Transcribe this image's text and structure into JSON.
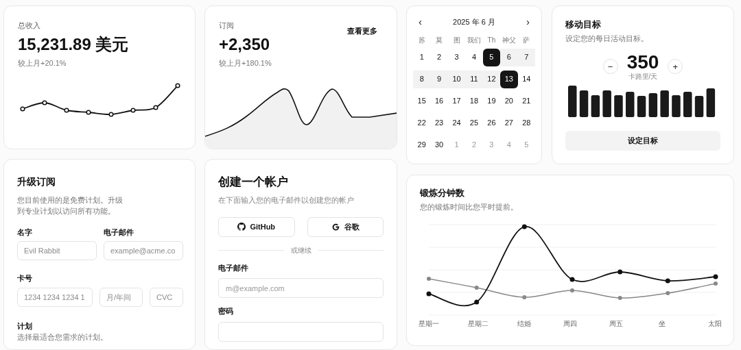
{
  "revenue": {
    "label": "总收入",
    "value": "15,231.89 美元",
    "change": "较上月+20.1%"
  },
  "subscriptions": {
    "label": "订阅",
    "value": "+2,350",
    "change": "较上月+180.1%",
    "link": "查看更多"
  },
  "calendar": {
    "prev": "‹",
    "title": "2025 年 6 月",
    "next": "›",
    "weekdays": [
      "苏",
      "莫",
      "图",
      "我们",
      "Th",
      "神父",
      "萨"
    ],
    "days": [
      {
        "label": "1",
        "outside": false,
        "selected": false,
        "in_range": false
      },
      {
        "label": "2",
        "outside": false,
        "selected": false,
        "in_range": false
      },
      {
        "label": "3",
        "outside": false,
        "selected": false,
        "in_range": false
      },
      {
        "label": "4",
        "outside": false,
        "selected": false,
        "in_range": false
      },
      {
        "label": "5",
        "outside": false,
        "selected": true,
        "in_range": true
      },
      {
        "label": "6",
        "outside": false,
        "selected": false,
        "in_range": true
      },
      {
        "label": "7",
        "outside": false,
        "selected": false,
        "in_range": true
      },
      {
        "label": "8",
        "outside": false,
        "selected": false,
        "in_range": true
      },
      {
        "label": "9",
        "outside": false,
        "selected": false,
        "in_range": true
      },
      {
        "label": "10",
        "outside": false,
        "selected": false,
        "in_range": true
      },
      {
        "label": "11",
        "outside": false,
        "selected": false,
        "in_range": true
      },
      {
        "label": "12",
        "outside": false,
        "selected": false,
        "in_range": true
      },
      {
        "label": "13",
        "outside": false,
        "selected": true,
        "in_range": true
      },
      {
        "label": "14",
        "outside": false,
        "selected": false,
        "in_range": false
      },
      {
        "label": "15",
        "outside": false,
        "selected": false,
        "in_range": false
      },
      {
        "label": "16",
        "outside": false,
        "selected": false,
        "in_range": false
      },
      {
        "label": "17",
        "outside": false,
        "selected": false,
        "in_range": false
      },
      {
        "label": "18",
        "outside": false,
        "selected": false,
        "in_range": false
      },
      {
        "label": "19",
        "outside": false,
        "selected": false,
        "in_range": false
      },
      {
        "label": "20",
        "outside": false,
        "selected": false,
        "in_range": false
      },
      {
        "label": "21",
        "outside": false,
        "selected": false,
        "in_range": false
      },
      {
        "label": "22",
        "outside": false,
        "selected": false,
        "in_range": false
      },
      {
        "label": "23",
        "outside": false,
        "selected": false,
        "in_range": false
      },
      {
        "label": "24",
        "outside": false,
        "selected": false,
        "in_range": false
      },
      {
        "label": "25",
        "outside": false,
        "selected": false,
        "in_range": false
      },
      {
        "label": "26",
        "outside": false,
        "selected": false,
        "in_range": false
      },
      {
        "label": "27",
        "outside": false,
        "selected": false,
        "in_range": false
      },
      {
        "label": "28",
        "outside": false,
        "selected": false,
        "in_range": false
      },
      {
        "label": "29",
        "outside": false,
        "selected": false,
        "in_range": false
      },
      {
        "label": "30",
        "outside": false,
        "selected": false,
        "in_range": false
      },
      {
        "label": "1",
        "outside": true,
        "selected": false,
        "in_range": false
      },
      {
        "label": "2",
        "outside": true,
        "selected": false,
        "in_range": false
      },
      {
        "label": "3",
        "outside": true,
        "selected": false,
        "in_range": false
      },
      {
        "label": "4",
        "outside": true,
        "selected": false,
        "in_range": false
      },
      {
        "label": "5",
        "outside": true,
        "selected": false,
        "in_range": false
      }
    ]
  },
  "move_goal": {
    "title": "移动目标",
    "description": "设定您的每日活动目标。",
    "minus": "−",
    "value": "350",
    "unit": "卡路里/天",
    "plus": "+",
    "button": "设定目标"
  },
  "upgrade": {
    "title": "升级订阅",
    "description": "您目前使用的是免费计划。升级到专业计划以访问所有功能。",
    "name_label": "名字",
    "name_placeholder": "Evil Rabbit",
    "email_label": "电子邮件",
    "email_placeholder": "example@acme.co",
    "card_label": "卡号",
    "card_placeholder": "1234 1234 1234 1",
    "expiry_placeholder": "月/年间",
    "cvc_placeholder": "CVC",
    "plan_label": "计划",
    "plan_description": "选择最适合您需求的计划。"
  },
  "create_account": {
    "title": "创建一个帐户",
    "description": "在下面输入您的电子邮件以创建您的帐户",
    "github": "GitHub",
    "google": "谷歌",
    "divider": "或继续",
    "email_label": "电子邮件",
    "email_placeholder": "m@example.com",
    "password_label": "密码"
  },
  "exercise": {
    "title": "锻炼分钟数",
    "description": "您的锻炼时间比您平时提前。",
    "days": [
      "星期一",
      "星期二",
      "结婚",
      "周四",
      "周五",
      "坐",
      "太阳"
    ]
  }
}
